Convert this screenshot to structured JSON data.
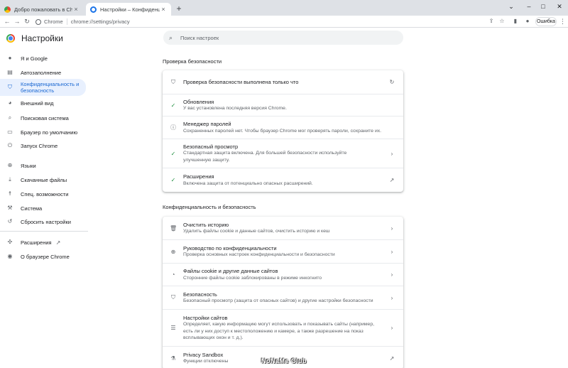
{
  "browser": {
    "tabs": [
      {
        "title": "Добро пожаловать в Chrome!",
        "close": "×"
      },
      {
        "title": "Настройки – Конфиденциальнос",
        "close": "×"
      }
    ],
    "new_tab": "+",
    "window_controls": {
      "chevron": "⌄",
      "minimize": "–",
      "maximize": "□",
      "close": "✕"
    },
    "address_chip": "Chrome",
    "url": "chrome://settings/privacy",
    "incognito_button": "Ошибка"
  },
  "settings": {
    "title": "Настройки",
    "search_placeholder": "Поиск настроек",
    "sidebar": [
      {
        "label": "Я и Google",
        "icon": "person-icon"
      },
      {
        "label": "Автозаполнение",
        "icon": "autofill-icon"
      },
      {
        "label": "Конфиденциальность и безопасность",
        "icon": "shield-icon",
        "active": true
      },
      {
        "label": "Внешний вид",
        "icon": "palette-icon"
      },
      {
        "label": "Поисковая система",
        "icon": "search-icon"
      },
      {
        "label": "Браузер по умолчанию",
        "icon": "browser-icon"
      },
      {
        "label": "Запуск Chrome",
        "icon": "power-icon"
      },
      {
        "label": "Языки",
        "icon": "globe-icon"
      },
      {
        "label": "Скачанные файлы",
        "icon": "download-icon"
      },
      {
        "label": "Спец. возможности",
        "icon": "accessibility-icon"
      },
      {
        "label": "Система",
        "icon": "wrench-icon"
      },
      {
        "label": "Сбросить настройки",
        "icon": "reset-icon"
      },
      {
        "label": "Расширения",
        "icon": "puzzle-icon"
      },
      {
        "label": "О браузере Chrome",
        "icon": "chrome-icon"
      }
    ],
    "safety_check": {
      "heading": "Проверка безопасности",
      "rows": [
        {
          "title": "Проверка безопасности выполнена только что",
          "subtitle": "",
          "icon": "shield-icon",
          "trail": "refresh-icon"
        },
        {
          "title": "Обновления",
          "subtitle": "У вас установлена последняя версия Chrome.",
          "icon": "check-icon",
          "trail": ""
        },
        {
          "title": "Менеджер паролей",
          "subtitle": "Сохраненных паролей нет. Чтобы браузер Chrome мог проверять пароли, сохраните их.",
          "icon": "info-icon",
          "trail": ""
        },
        {
          "title": "Безопасный просмотр",
          "subtitle": "Стандартная защита включена. Для большей безопасности используйте улучшенную защиту.",
          "icon": "check-icon",
          "trail": "chevron-right-icon"
        },
        {
          "title": "Расширения",
          "subtitle": "Включена защита от потенциально опасных расширений.",
          "icon": "check-icon",
          "trail": "open-external-icon"
        }
      ]
    },
    "privacy": {
      "heading": "Конфиденциальность и безопасность",
      "rows": [
        {
          "title": "Очистить историю",
          "subtitle": "Удалить файлы cookie и данные сайтов, очистить историю и кеш",
          "icon": "trash-icon",
          "trail": "chevron-right-icon"
        },
        {
          "title": "Руководство по конфиденциальности",
          "subtitle": "Проверка основных настроек конфиденциальности и безопасности",
          "icon": "guide-icon",
          "trail": "chevron-right-icon"
        },
        {
          "title": "Файлы cookie и другие данные сайтов",
          "subtitle": "Сторонние файлы cookie заблокированы в режиме инкогнито",
          "icon": "cookie-icon",
          "trail": "chevron-right-icon"
        },
        {
          "title": "Безопасность",
          "subtitle": "Безопасный просмотр (защита от опасных сайтов) и другие настройки безопасности",
          "icon": "shield-icon",
          "trail": "chevron-right-icon"
        },
        {
          "title": "Настройки сайтов",
          "subtitle": "Определяет, какую информацию могут использовать и показывать сайты (например, есть ли у них доступ к местоположению и камере, а также разрешение на показ всплывающих окон и т. д.).",
          "icon": "sliders-icon",
          "trail": "chevron-right-icon"
        },
        {
          "title": "Privacy Sandbox",
          "subtitle": "Функции отключены",
          "icon": "flask-icon",
          "trail": "open-external-icon"
        }
      ]
    }
  },
  "watermark": "NoNaMe Club",
  "colors": {
    "accent": "#1967d2",
    "active_bg": "#e8f0fe",
    "ok": "#1e8e3e"
  }
}
